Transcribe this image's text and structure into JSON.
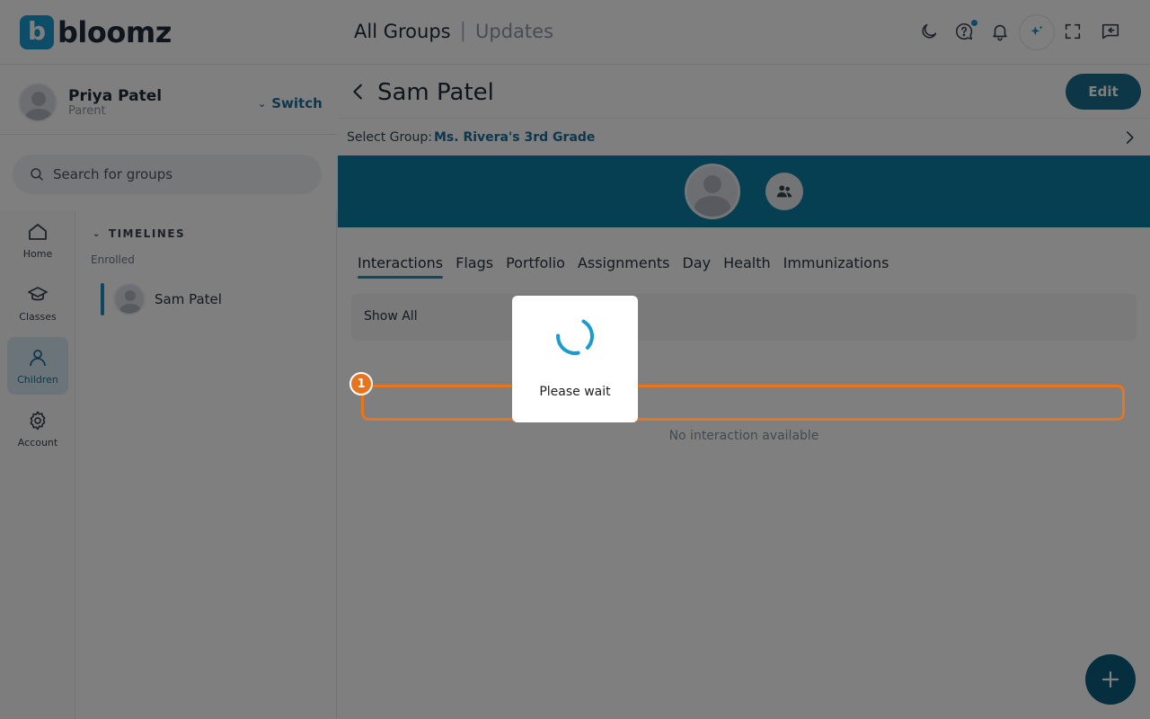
{
  "app": {
    "brand": "bloomz",
    "brand_mark": "b"
  },
  "header": {
    "title_primary": "All Groups",
    "separator": "|",
    "title_secondary": "Updates"
  },
  "user": {
    "name": "Priya Patel",
    "role": "Parent",
    "switch_label": "Switch"
  },
  "search": {
    "placeholder": "Search for groups"
  },
  "rail": {
    "items": [
      {
        "label": "Home",
        "icon": "home-icon"
      },
      {
        "label": "Classes",
        "icon": "graduation-cap-icon"
      },
      {
        "label": "Children",
        "icon": "person-icon",
        "active": true
      },
      {
        "label": "Account",
        "icon": "gear-icon"
      }
    ]
  },
  "timelines": {
    "heading": "TIMELINES",
    "subheading": "Enrolled",
    "children": [
      {
        "name": "Sam Patel"
      }
    ]
  },
  "main": {
    "student_name": "Sam Patel",
    "edit_label": "Edit",
    "select_group_label": "Select Group:",
    "selected_group": "Ms. Rivera's 3rd Grade",
    "tabs": [
      "Interactions",
      "Flags",
      "Portfolio",
      "Assignments",
      "Day",
      "Health",
      "Immunizations"
    ],
    "active_tab": "Interactions",
    "filter_label": "Show All",
    "empty_message": "No interaction available"
  },
  "overlay": {
    "step_number": "1",
    "loading_text": "Please wait"
  },
  "colors": {
    "brand": "#1b9ad0",
    "accent": "#1b6e8d",
    "banner": "#0b7fa3",
    "highlight": "#e8741e"
  }
}
